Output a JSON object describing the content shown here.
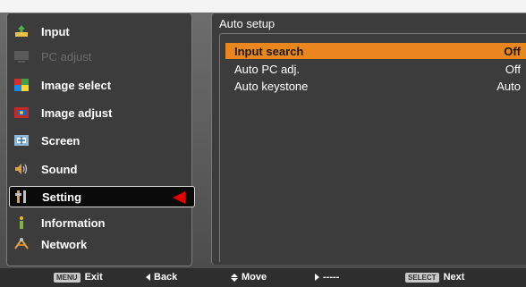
{
  "menu": {
    "items": [
      {
        "label": "Input",
        "icon": "input-icon",
        "state": "normal"
      },
      {
        "label": "PC adjust",
        "icon": "pc-adjust-icon",
        "state": "disabled"
      },
      {
        "label": "Image select",
        "icon": "image-select-icon",
        "state": "normal"
      },
      {
        "label": "Image adjust",
        "icon": "image-adjust-icon",
        "state": "normal"
      },
      {
        "label": "Screen",
        "icon": "screen-icon",
        "state": "normal"
      },
      {
        "label": "Sound",
        "icon": "sound-icon",
        "state": "normal"
      },
      {
        "label": "Setting",
        "icon": "setting-icon",
        "state": "selected"
      },
      {
        "label": "Information",
        "icon": "information-icon",
        "state": "normal"
      },
      {
        "label": "Network",
        "icon": "network-icon",
        "state": "normal"
      }
    ]
  },
  "content": {
    "title": "Auto setup",
    "rows": [
      {
        "label": "Input search",
        "value": "Off",
        "selected": true
      },
      {
        "label": "Auto PC adj.",
        "value": "Off",
        "selected": false
      },
      {
        "label": "Auto keystone",
        "value": "Auto",
        "selected": false
      }
    ]
  },
  "footer": {
    "exit_key": "MENU",
    "exit_label": "Exit",
    "back_label": "Back",
    "move_label": "Move",
    "right_label": "-----",
    "next_key": "SELECT",
    "next_label": "Next"
  },
  "colors": {
    "highlight": "#e9861e",
    "selector_arrow": "#e60000",
    "panel_bg": "#3c3c3c"
  }
}
